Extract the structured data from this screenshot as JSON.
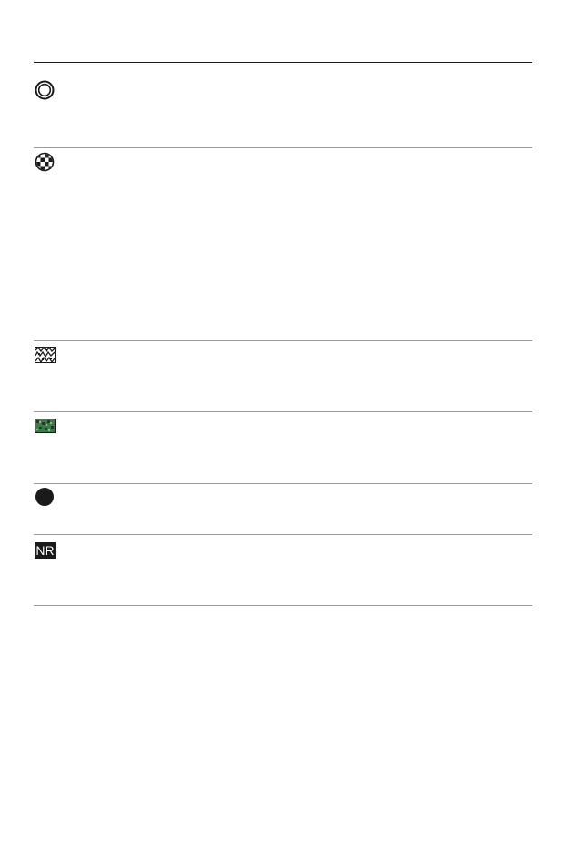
{
  "table": {
    "rows": [
      {
        "icon": "ring-icon"
      },
      {
        "icon": "checker-circle-icon"
      },
      {
        "icon": "texture-pattern-icon"
      },
      {
        "icon": "color-texture-icon"
      },
      {
        "icon": "filled-circle-icon"
      },
      {
        "icon": "noise-reduction-icon",
        "icon_text": "NR"
      }
    ]
  }
}
